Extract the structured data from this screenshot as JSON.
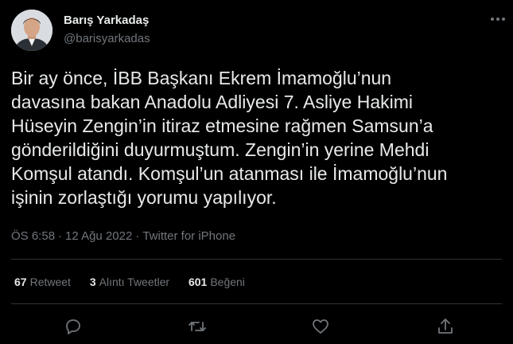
{
  "user": {
    "name": "Barış Yarkadaş",
    "handle": "@barisyarkadas"
  },
  "tweet": {
    "lines": [
      "Bir ay önce, İBB Başkanı Ekrem İmamoğlu’nun",
      "davasına bakan Anadolu Adliyesi 7. Asliye Hakimi",
      "Hüseyin Zengin’in itiraz etmesine rağmen Samsun’a",
      "gönderildiğini duyurmuştum. Zengin’in yerine Mehdi",
      "Komşul atandı. Komşul’un atanması ile İmamoğlu’nun",
      "işinin zorlaştığı yorumu yapılıyor."
    ]
  },
  "meta": {
    "time": "ÖS 6:58",
    "separator": "·",
    "date": "12 Ağu 2022",
    "source": "Twitter for iPhone"
  },
  "stats": {
    "retweets": {
      "count": "67",
      "label": "Retweet"
    },
    "quotes": {
      "count": "3",
      "label": "Alıntı Tweetler"
    },
    "likes": {
      "count": "601",
      "label": "Beğeni"
    }
  },
  "icons": {
    "more": "more-horizontal-icon",
    "reply": "reply-icon",
    "retweet": "retweet-icon",
    "like": "heart-icon",
    "share": "share-icon"
  },
  "colors": {
    "background": "#000000",
    "text": "#e7e9ea",
    "secondary": "#71767b",
    "divider": "#2f3336"
  }
}
